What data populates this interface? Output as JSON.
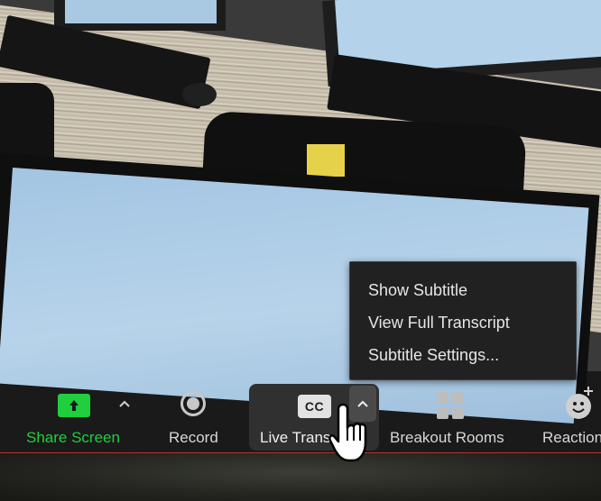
{
  "popup_menu": {
    "items": [
      {
        "label": "Show Subtitle"
      },
      {
        "label": "View Full Transcript"
      },
      {
        "label": "Subtitle Settings..."
      }
    ]
  },
  "toolbar": {
    "share_screen_label": "Share Screen",
    "record_label": "Record",
    "live_transcript_label": "Live Trans",
    "cc_icon_text": "CC",
    "breakout_rooms_label": "Breakout Rooms",
    "reactions_label": "Reaction"
  },
  "colors": {
    "share_accent": "#1fcf3e",
    "toolbar_bg": "#1a1a1a",
    "popup_bg": "#212121"
  },
  "icons": [
    "share-screen-icon",
    "chevron-up-icon",
    "record-icon",
    "cc-icon",
    "breakout-rooms-icon",
    "reaction-emoji-icon",
    "hand-cursor-icon"
  ]
}
